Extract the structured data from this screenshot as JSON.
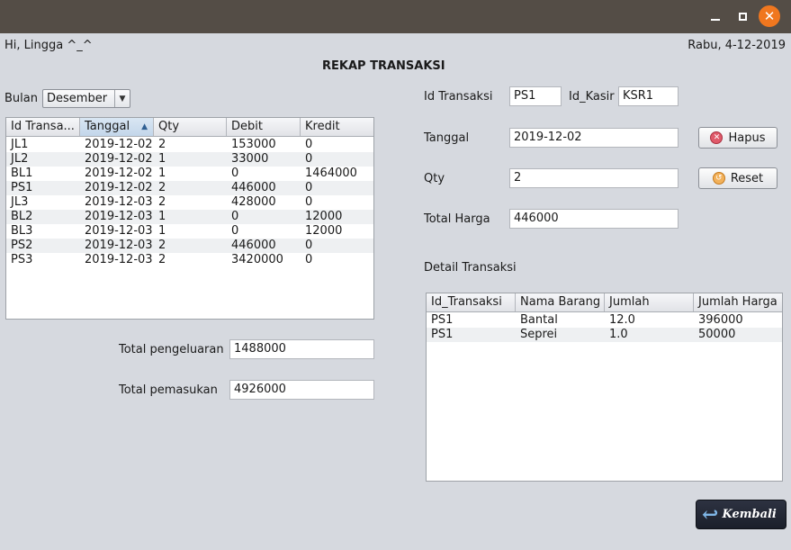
{
  "window": {
    "minimize": "–",
    "close": "✕"
  },
  "header": {
    "greeting": "Hi, Lingga ^_^",
    "date": "Rabu, 4-12-2019",
    "title": "REKAP TRANSAKSI"
  },
  "filter": {
    "label": "Bulan",
    "value": "Desember"
  },
  "rekap": {
    "columns": [
      "Id Transa...",
      "Tanggal",
      "Qty",
      "Debit",
      "Kredit"
    ],
    "rows": [
      [
        "JL1",
        "2019-12-02",
        "2",
        "153000",
        "0"
      ],
      [
        "JL2",
        "2019-12-02",
        "1",
        "33000",
        "0"
      ],
      [
        "BL1",
        "2019-12-02",
        "1",
        "0",
        "1464000"
      ],
      [
        "PS1",
        "2019-12-02",
        "2",
        "446000",
        "0"
      ],
      [
        "JL3",
        "2019-12-03",
        "2",
        "428000",
        "0"
      ],
      [
        "BL2",
        "2019-12-03",
        "1",
        "0",
        "12000"
      ],
      [
        "BL3",
        "2019-12-03",
        "1",
        "0",
        "12000"
      ],
      [
        "PS2",
        "2019-12-03",
        "2",
        "446000",
        "0"
      ],
      [
        "PS3",
        "2019-12-03",
        "2",
        "3420000",
        "0"
      ]
    ]
  },
  "totals": {
    "pengeluaran_label": "Total pengeluaran",
    "pengeluaran_value": "1488000",
    "pemasukan_label": "Total pemasukan",
    "pemasukan_value": "4926000"
  },
  "form": {
    "id_transaksi_label": "Id Transaksi",
    "id_transaksi_value": "PS1",
    "id_kasir_label": "Id_Kasir",
    "id_kasir_value": "KSR1",
    "tanggal_label": "Tanggal",
    "tanggal_value": "2019-12-02",
    "qty_label": "Qty",
    "qty_value": "2",
    "total_harga_label": "Total Harga",
    "total_harga_value": "446000",
    "hapus_label": "Hapus",
    "reset_label": "Reset"
  },
  "detail": {
    "title": "Detail Transaksi",
    "columns": [
      "Id_Transaksi",
      "Nama Barang",
      "Jumlah",
      "Jumlah Harga"
    ],
    "rows": [
      [
        "PS1",
        "Bantal",
        "12.0",
        "396000"
      ],
      [
        "PS1",
        "Seprei",
        "1.0",
        "50000"
      ]
    ]
  },
  "back_button": {
    "label": "Kembali"
  },
  "colors": {
    "titlebar": "#544d46",
    "close": "#f0771f",
    "background": "#d6d9df"
  }
}
